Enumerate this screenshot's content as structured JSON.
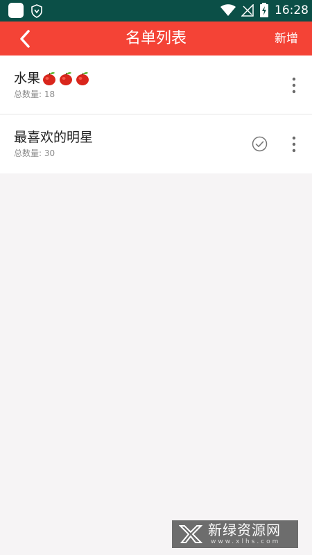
{
  "status_bar": {
    "time": "16:28",
    "icons": [
      "app-square-icon",
      "shield-icon",
      "wifi-icon",
      "signal-icon",
      "battery-charging-icon"
    ]
  },
  "app_bar": {
    "title": "名单列表",
    "back_icon": "back-chevron-icon",
    "add_label": "新增",
    "color": "#f44336"
  },
  "list": {
    "items": [
      {
        "title": "水果",
        "emoji_count": 3,
        "emoji": "apple-icon",
        "subtitle": "总数量: 18",
        "checked": false,
        "menu_icon": "more-vertical-icon"
      },
      {
        "title": "最喜欢的明星",
        "subtitle": "总数量: 30",
        "checked": true,
        "menu_icon": "more-vertical-icon"
      }
    ]
  },
  "watermark": {
    "title": "新绿资源网",
    "url": "www.xlhs.com"
  },
  "colors": {
    "status_bar": "#0b4f47",
    "accent": "#f44336",
    "background": "#f6f4f5"
  }
}
